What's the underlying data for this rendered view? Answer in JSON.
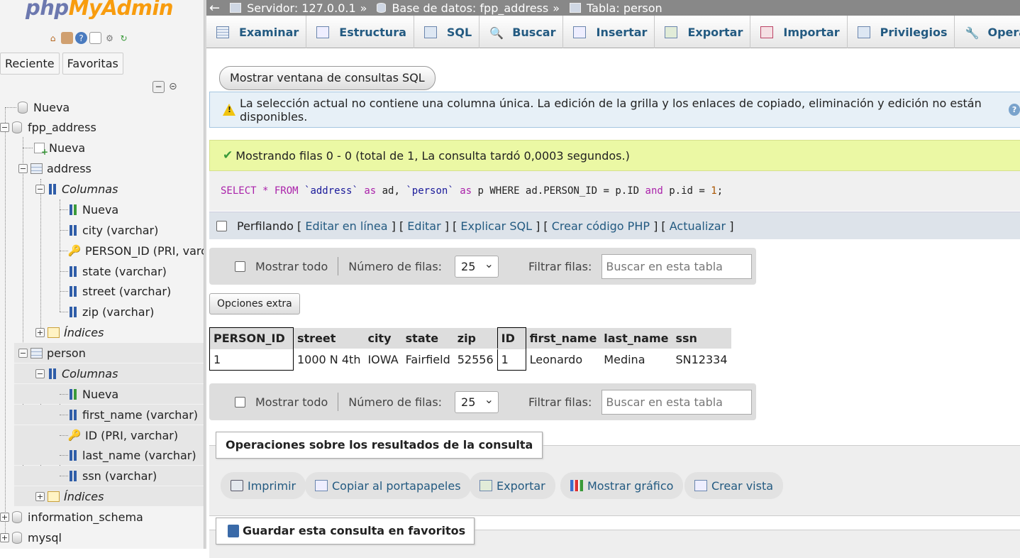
{
  "app": {
    "logo_part1": "php",
    "logo_part2": "MyAdmin"
  },
  "sidebar": {
    "tabs": [
      "Reciente",
      "Favoritas"
    ],
    "tree": {
      "nueva_root": "Nueva",
      "db1": "fpp_address",
      "db1_nueva": "Nueva",
      "table_address": "address",
      "address_columns": "Columnas",
      "address_cols_nueva": "Nueva",
      "address_col_city": "city (varchar)",
      "address_col_person_id": "PERSON_ID (PRI, varchar)",
      "address_col_state": "state (varchar)",
      "address_col_street": "street (varchar)",
      "address_col_zip": "zip (varchar)",
      "address_indices": "Índices",
      "table_person": "person",
      "person_columns": "Columnas",
      "person_cols_nueva": "Nueva",
      "person_col_first_name": "first_name (varchar)",
      "person_col_id": "ID (PRI, varchar)",
      "person_col_last_name": "last_name (varchar)",
      "person_col_ssn": "ssn (varchar)",
      "person_indices": "Índices",
      "db2": "information_schema",
      "db3": "mysql"
    }
  },
  "breadcrumb": {
    "server": "Servidor: 127.0.0.1",
    "sep": "»",
    "database": "Base de datos: fpp_address",
    "table": "Tabla: person"
  },
  "tabs": [
    "Examinar",
    "Estructura",
    "SQL",
    "Buscar",
    "Insertar",
    "Exportar",
    "Importar",
    "Privilegios",
    "Operaciones"
  ],
  "main": {
    "sql_window_button": "Mostrar ventana de consultas SQL",
    "notice": "La selección actual no contiene una columna única. La edición de la grilla y los enlaces de copiado, eliminación y edición no están disponibles.",
    "success": "Mostrando filas 0 - 0 (total de 1, La consulta tardó 0,0003 segundos.)",
    "sql": {
      "select": "SELECT",
      "star": " * ",
      "from": "FROM",
      "t1": " `address`",
      "as1": " as",
      "a1": " ad, ",
      "t2": "`person`",
      "as2": " as",
      "rest1": " p WHERE ad.PERSON_ID = p.ID ",
      "and": "and",
      "rest2": " p.id = ",
      "one": "1",
      "semi": ";"
    },
    "profiling": {
      "label": "Perfilando",
      "links": [
        "Editar en línea",
        "Editar",
        "Explicar SQL",
        "Crear código PHP",
        "Actualizar"
      ]
    },
    "nav": {
      "show_all": "Mostrar todo",
      "rows_label": "Número de filas:",
      "rows_value": "25",
      "filter_label": "Filtrar filas:",
      "filter_placeholder": "Buscar en esta tabla"
    },
    "extra_options": "Opciones extra",
    "table": {
      "headers": [
        "PERSON_ID",
        "street",
        "city",
        "state",
        "zip",
        "ID",
        "first_name",
        "last_name",
        "ssn"
      ],
      "rows": [
        [
          "1",
          "1000 N 4th",
          "IOWA",
          "Fairfield",
          "52556",
          "1",
          "Leonardo",
          "Medina",
          "SN12334"
        ]
      ]
    },
    "query_ops": {
      "title": "Operaciones sobre los resultados de la consulta",
      "buttons": [
        "Imprimir",
        "Copiar al portapapeles",
        "Exportar",
        "Mostrar gráfico",
        "Crear vista"
      ]
    },
    "bookmark": {
      "title": "Guardar esta consulta en favoritos"
    }
  }
}
